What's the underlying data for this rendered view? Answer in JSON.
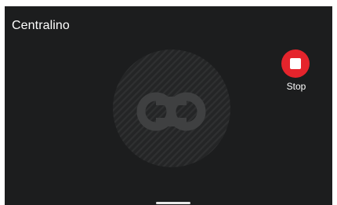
{
  "app": {
    "title": "Centralino"
  },
  "actions": {
    "stop_label": "Stop"
  },
  "icons": {
    "center_logo": "intercom-logo-icon",
    "stop": "stop-icon"
  },
  "colors": {
    "background": "#1c1d1e",
    "stop_button": "#e5242c",
    "logo_disc": "#2a2b2c",
    "logo_mark": "#3b3c3d",
    "text": "#ffffff"
  }
}
